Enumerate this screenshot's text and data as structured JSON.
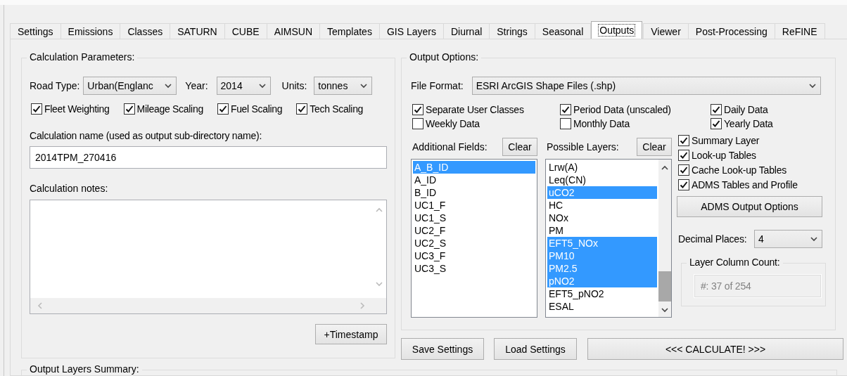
{
  "tabs": [
    {
      "label": "Settings",
      "selected": false
    },
    {
      "label": "Emissions",
      "selected": false
    },
    {
      "label": "Classes",
      "selected": false
    },
    {
      "label": "SATURN",
      "selected": false
    },
    {
      "label": "CUBE",
      "selected": false
    },
    {
      "label": "AIMSUN",
      "selected": false
    },
    {
      "label": "Templates",
      "selected": false
    },
    {
      "label": "GIS Layers",
      "selected": false
    },
    {
      "label": "Diurnal",
      "selected": false
    },
    {
      "label": "Strings",
      "selected": false
    },
    {
      "label": "Seasonal",
      "selected": false
    },
    {
      "label": "Outputs",
      "selected": true
    },
    {
      "label": "Viewer",
      "selected": false
    },
    {
      "label": "Post-Processing",
      "selected": false
    },
    {
      "label": "ReFINE",
      "selected": false
    }
  ],
  "calculation_parameters": {
    "title": "Calculation Parameters:",
    "road_type": {
      "label": "Road Type:",
      "value": "Urban(Englanc"
    },
    "year": {
      "label": "Year:",
      "value": "2014"
    },
    "units": {
      "label": "Units:",
      "value": "tonnes"
    },
    "options": [
      {
        "label": "Fleet Weighting",
        "checked": true
      },
      {
        "label": "Mileage Scaling",
        "checked": true
      },
      {
        "label": "Fuel Scaling",
        "checked": true
      },
      {
        "label": "Tech Scaling",
        "checked": true
      }
    ],
    "name_label": "Calculation name (used as output sub-directory name):",
    "name_value": "2014TPM_270416",
    "notes_label": "Calculation notes:",
    "timestamp_button": "+Timestamp"
  },
  "output_options": {
    "title": "Output Options:",
    "file_format": {
      "label": "File Format:",
      "value": "ESRI ArcGIS Shape Files (.shp)"
    },
    "data_options": [
      {
        "label": "Separate User Classes",
        "checked": true
      },
      {
        "label": "Period Data (unscaled)",
        "checked": true
      },
      {
        "label": "Daily Data",
        "checked": true
      },
      {
        "label": "Weekly Data",
        "checked": false
      },
      {
        "label": "Monthly Data",
        "checked": false
      },
      {
        "label": "Yearly Data",
        "checked": true
      }
    ],
    "additional_fields": {
      "label": "Additional Fields:",
      "clear_button": "Clear",
      "items": [
        {
          "text": "A_B_ID",
          "selected": true
        },
        {
          "text": "A_ID",
          "selected": false
        },
        {
          "text": "B_ID",
          "selected": false
        },
        {
          "text": "UC1_F",
          "selected": false
        },
        {
          "text": "UC1_S",
          "selected": false
        },
        {
          "text": "UC2_F",
          "selected": false
        },
        {
          "text": "UC2_S",
          "selected": false
        },
        {
          "text": "UC3_F",
          "selected": false
        },
        {
          "text": "UC3_S",
          "selected": false
        }
      ]
    },
    "possible_layers": {
      "label": "Possible Layers:",
      "clear_button": "Clear",
      "items": [
        {
          "text": "Lrw(A)",
          "selected": false
        },
        {
          "text": "Leq(CN)",
          "selected": false
        },
        {
          "text": "uCO2",
          "selected": true
        },
        {
          "text": "HC",
          "selected": false
        },
        {
          "text": "NOx",
          "selected": false
        },
        {
          "text": "PM",
          "selected": false
        },
        {
          "text": "EFT5_NOx",
          "selected": true
        },
        {
          "text": "PM10",
          "selected": true
        },
        {
          "text": "PM2.5",
          "selected": true
        },
        {
          "text": "pNO2",
          "selected": true
        },
        {
          "text": "EFT5_pNO2",
          "selected": false
        },
        {
          "text": "ESAL",
          "selected": false
        }
      ]
    },
    "layer_options": [
      {
        "label": "Summary Layer",
        "checked": true
      },
      {
        "label": "Look-up Tables",
        "checked": true
      },
      {
        "label": "Cache Look-up Tables",
        "checked": true
      },
      {
        "label": "ADMS Tables and Profile",
        "checked": true
      }
    ],
    "adms_button": "ADMS Output Options",
    "decimal_places": {
      "label": "Decimal Places:",
      "value": "4"
    },
    "layer_column_count": {
      "title": "Layer Column Count:",
      "value": "#: 37 of 254",
      "disabled": true
    }
  },
  "buttons": {
    "save": "Save Settings",
    "load": "Load Settings",
    "calculate": "<<< CALCULATE! >>>"
  },
  "output_layers_summary": {
    "title": "Output Layers Summary:"
  }
}
